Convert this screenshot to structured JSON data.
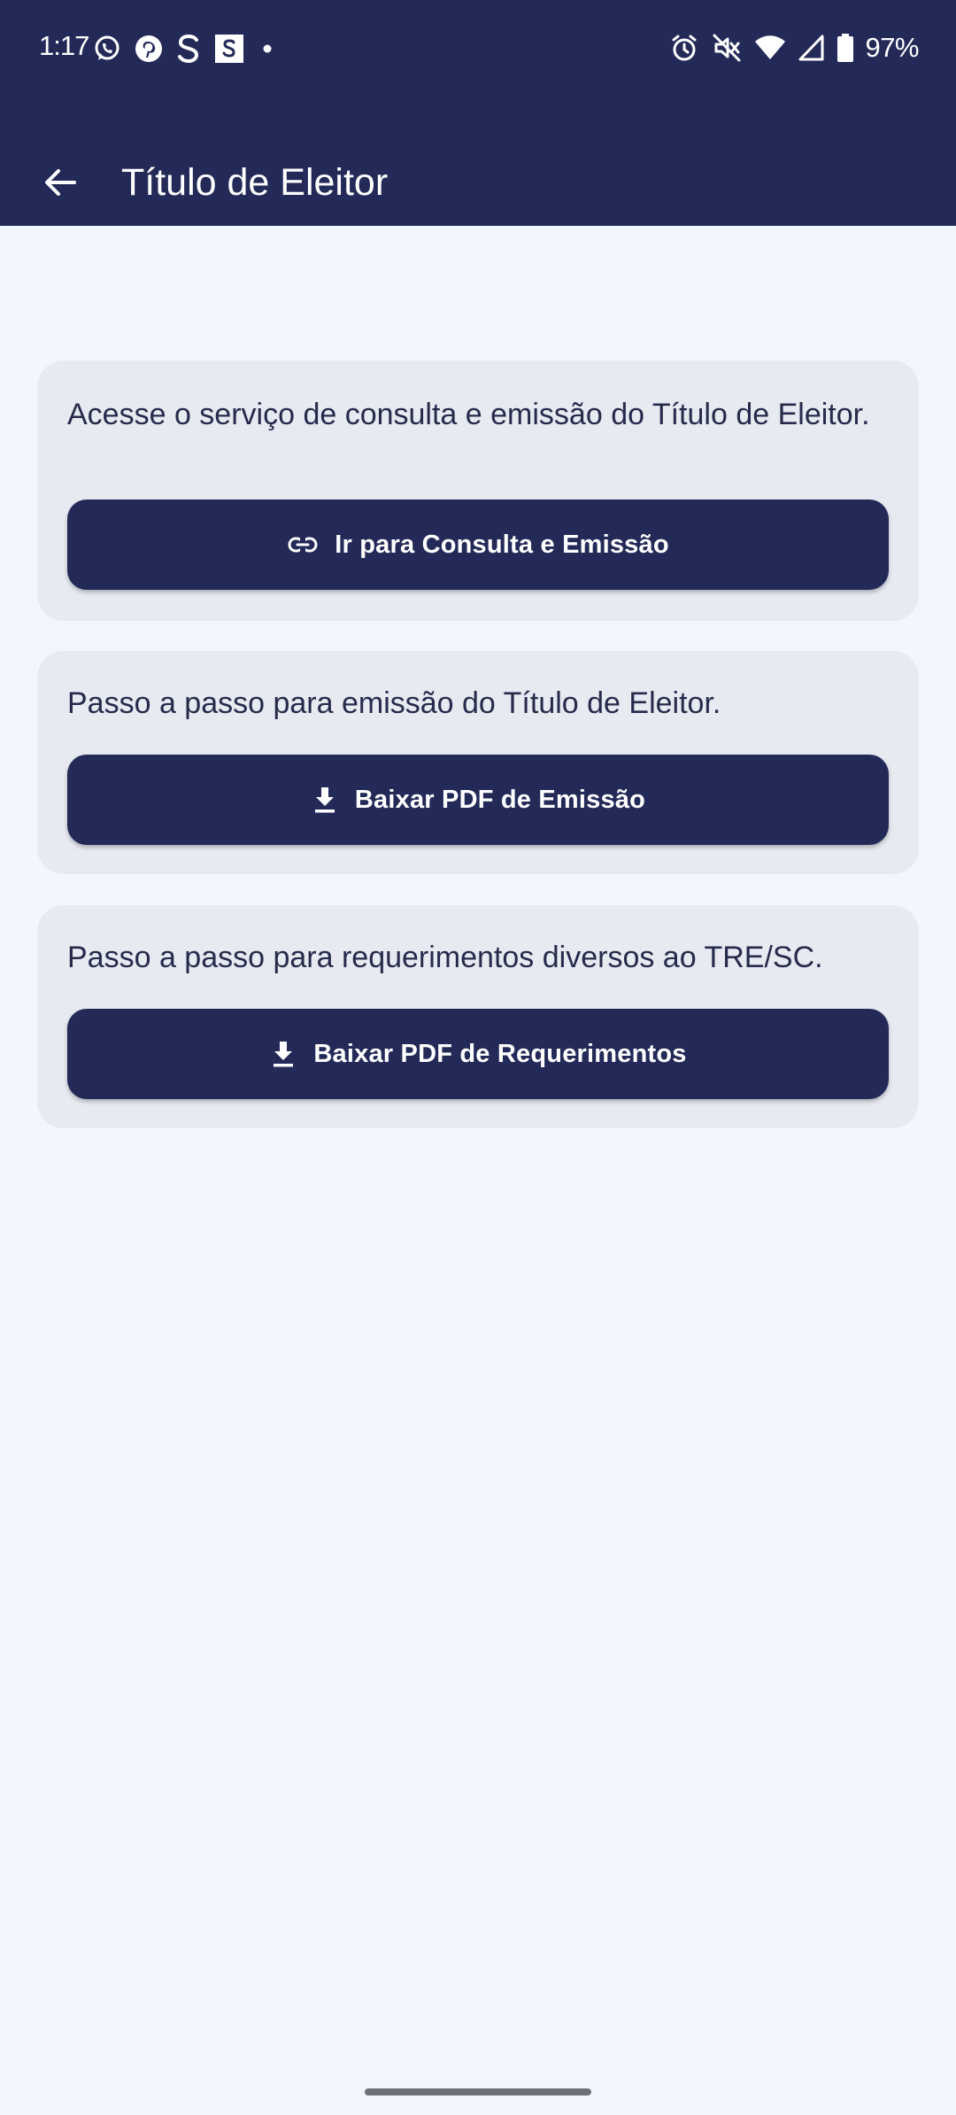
{
  "status_bar": {
    "time": "1:17",
    "battery_percent": "97%",
    "left_icons": [
      "whatsapp-icon",
      "pinterest-icon",
      "s-app-icon",
      "s-box-app-icon",
      "dot-icon"
    ],
    "right_icons": [
      "alarm-icon",
      "vibrate-off-icon",
      "wifi-icon",
      "signal-icon",
      "battery-icon"
    ]
  },
  "app_bar": {
    "title": "Título de Eleitor",
    "back_icon": "arrow-back-icon"
  },
  "cards": [
    {
      "text": "Acesse o serviço de consulta e emissão do Título de Eleitor.",
      "button_label": "Ir para Consulta e Emissão",
      "button_icon": "link-icon"
    },
    {
      "text": "Passo a passo para emissão do Título de Eleitor.",
      "button_label": "Baixar PDF de Emissão",
      "button_icon": "download-icon"
    },
    {
      "text": "Passo a passo para requerimentos diversos ao TRE/SC.",
      "button_label": "Baixar PDF de Requerimentos",
      "button_icon": "download-icon"
    }
  ],
  "colors": {
    "primary": "#232a58",
    "background": "#f3f6fd",
    "card": "#e7eaf1",
    "text": "#262b4c"
  }
}
